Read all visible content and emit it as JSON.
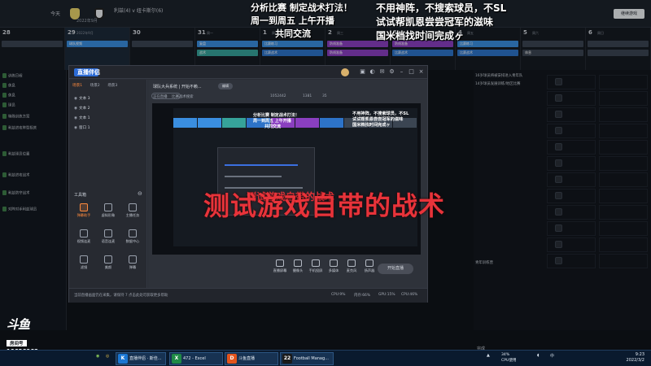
{
  "overlay": {
    "line1": "分析比赛 制定战术打法！",
    "line2": "周一到周五 上午开播",
    "line3": "共同交流",
    "right1": "不用神阵，不搜索球员，不SL",
    "right2": "试试帮凯恩尝尝冠军的滋味",
    "right3": "国米档找时间完成ヶ",
    "big_red": "测试游戏自带的战术"
  },
  "game": {
    "manager_label": "今天",
    "match": "利兹(4) v 纽卡斯尔(6)",
    "date": "2022年9月",
    "continue": "继续游戏",
    "calendar": [
      {
        "num": "28",
        "wd": "",
        "events": [
          {
            "t": "",
            "c": "#3b4552"
          }
        ]
      },
      {
        "num": "29",
        "wd": "2022年9月",
        "events": [
          {
            "t": "球队视频",
            "c": "#3a8ee0"
          }
        ]
      },
      {
        "num": "30",
        "wd": "",
        "events": [
          {
            "t": "",
            "c": "#3b4552"
          }
        ]
      },
      {
        "num": "31",
        "wd": "周一",
        "events": [
          {
            "t": "复盘",
            "c": "#3a8ee0"
          },
          {
            "t": "战术",
            "c": "#36a39a"
          }
        ]
      },
      {
        "num": "1",
        "wd": "周二",
        "events": [
          {
            "t": "比赛练习",
            "c": "#3a8ee0"
          },
          {
            "t": "比赛战术",
            "c": "#2d73c8"
          }
        ]
      },
      {
        "num": "2",
        "wd": "周三",
        "events": [
          {
            "t": "防线准备",
            "c": "#8a3fc0"
          },
          {
            "t": "防线准备",
            "c": "#8a3fc0"
          }
        ]
      },
      {
        "num": "3",
        "wd": "周四",
        "events": [
          {
            "t": "防线准备",
            "c": "#8a3fc0"
          },
          {
            "t": "比赛战术",
            "c": "#2d73c8"
          }
        ]
      },
      {
        "num": "4",
        "wd": "周五",
        "events": [
          {
            "t": "比赛练习",
            "c": "#3a8ee0"
          },
          {
            "t": "比赛战术",
            "c": "#2d73c8"
          }
        ]
      },
      {
        "num": "5",
        "wd": "周六",
        "events": [
          {
            "t": "",
            "c": "#3b4552"
          },
          {
            "t": "休息",
            "c": "#3b4552"
          }
        ]
      },
      {
        "num": "6",
        "wd": "周日",
        "events": [
          {
            "t": "",
            "c": "#3b4552"
          },
          {
            "t": "",
            "c": "#3b4552"
          }
        ]
      }
    ],
    "left_items": [
      "训练日程",
      "休息",
      "休息",
      "球员",
      "特殊训练方案",
      "利兹进攻阵型相关",
      "利兹球员位置",
      "利兹进攻战术",
      "利兹防守战术",
      "对阵对手利兹球员"
    ],
    "right_rows": [
      "16岁球员将被安排进入青年队",
      "14岁球员发展训练/地区比赛",
      "",
      "",
      "",
      "",
      "",
      "",
      "",
      "",
      "",
      "",
      "",
      "",
      "",
      "",
      "",
      "",
      "",
      "",
      "",
      "",
      "",
      "青年训练营"
    ],
    "right_bottom": "完成",
    "right_bottom2": "选择"
  },
  "app": {
    "name": "直播伴侣",
    "tabs": [
      "场景1",
      "场景2",
      "场景3"
    ],
    "scenes": [
      "文本 3",
      "文本 2",
      "文本 1",
      "窗口 1"
    ],
    "tools_title": "工具箱",
    "tools": [
      {
        "label": "弹幕助手",
        "active": true
      },
      {
        "label": "虚拟形象",
        "active": false
      },
      {
        "label": "主播任务",
        "active": false
      },
      {
        "label": "视频连麦",
        "active": false
      },
      {
        "label": "语音连麦",
        "active": false
      },
      {
        "label": "数据中心",
        "active": false
      },
      {
        "label": "滤镜",
        "active": false
      },
      {
        "label": "美颜",
        "active": false
      },
      {
        "label": "弹幕",
        "active": false
      }
    ],
    "room_title": "球队大兵系统 | 开始不赖...",
    "room_btn": "编辑",
    "room_sub_label": "正在直播",
    "room_sub_rest": "比赛战术搜索",
    "room_stats": [
      "1052442",
      "1381",
      "35"
    ],
    "controls": [
      "直播屏幕",
      "摄像头",
      "手机投屏",
      "多媒体",
      "麦克风",
      "扬声器"
    ],
    "start": "开始直播",
    "status": "当前直播画面仍在采集，请保持 7 点击此处可获取更多帮助",
    "metrics": [
      "CPU:9%",
      "内存:66%",
      "GPU:15%",
      "CPU:46%"
    ]
  },
  "preview": {
    "line1": "分析比赛 制定战术打法！",
    "line2": "周一到周五 上午开播",
    "line3": "共同交流",
    "right1": "不用神阵，不搜索球员，不SL",
    "right2": "试试帮凯恩尝尝冠军的滋味",
    "right3": "国米档找时间完成ヶ",
    "red": "测试游戏自带的战术"
  },
  "brand": {
    "logo": "斗鱼",
    "sub": "房间号",
    "room_id": "10636962"
  },
  "taskbar": {
    "apps": [
      {
        "label": "",
        "icon": "start"
      },
      {
        "label": "",
        "icon": "chrome"
      },
      {
        "label": "直播伴侣 · 斯佳...",
        "icon": "K"
      },
      {
        "label": "472 - Excel",
        "icon": "X"
      },
      {
        "label": "斗鱼直播",
        "icon": "D"
      },
      {
        "label": "Football Manag...",
        "icon": "22"
      }
    ],
    "cpu_label": "34%",
    "cpu_sub": "CPU使用",
    "time": "9:23",
    "date": "2022/3/2"
  },
  "colors": {
    "accent_orange": "#ff8a3d",
    "overlay_red": "#e8333a",
    "calendar_blue": "#3a8ee0",
    "calendar_purple": "#8a3fc0",
    "calendar_teal": "#36a39a"
  }
}
